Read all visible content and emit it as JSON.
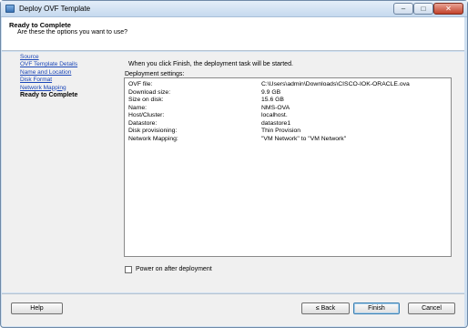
{
  "window": {
    "title": "Deploy OVF Template",
    "controls": {
      "minimize": "–",
      "maximize": "□",
      "close": "✕"
    }
  },
  "header": {
    "title": "Ready to Complete",
    "subtitle": "Are these the options you want to use?"
  },
  "steps": [
    {
      "label": "Source",
      "current": false
    },
    {
      "label": "OVF Template Details",
      "current": false
    },
    {
      "label": "Name and Location",
      "current": false
    },
    {
      "label": "Disk Format",
      "current": false
    },
    {
      "label": "Network Mapping",
      "current": false
    },
    {
      "label": "Ready to Complete",
      "current": true
    }
  ],
  "content": {
    "intro": "When you click Finish, the deployment task will be started.",
    "settings_label": "Deployment settings:",
    "settings": [
      {
        "key": "OVF file:",
        "value": "C:\\Users\\admin\\Downloads\\CISCO-IOK-ORACLE.ova"
      },
      {
        "key": "Download size:",
        "value": "9.9 GB"
      },
      {
        "key": "Size on disk:",
        "value": "15.6 GB"
      },
      {
        "key": "Name:",
        "value": "NMS-OVA"
      },
      {
        "key": "Host/Cluster:",
        "value": "localhost."
      },
      {
        "key": "Datastore:",
        "value": "datastore1"
      },
      {
        "key": "Disk provisioning:",
        "value": "Thin Provision"
      },
      {
        "key": "Network Mapping:",
        "value": "\"VM Network\" to \"VM Network\""
      }
    ],
    "power_on": {
      "label": "Power on after deployment",
      "checked": false
    }
  },
  "footer": {
    "help": "Help",
    "back": "≤ Back",
    "finish": "Finish",
    "cancel": "Cancel"
  }
}
